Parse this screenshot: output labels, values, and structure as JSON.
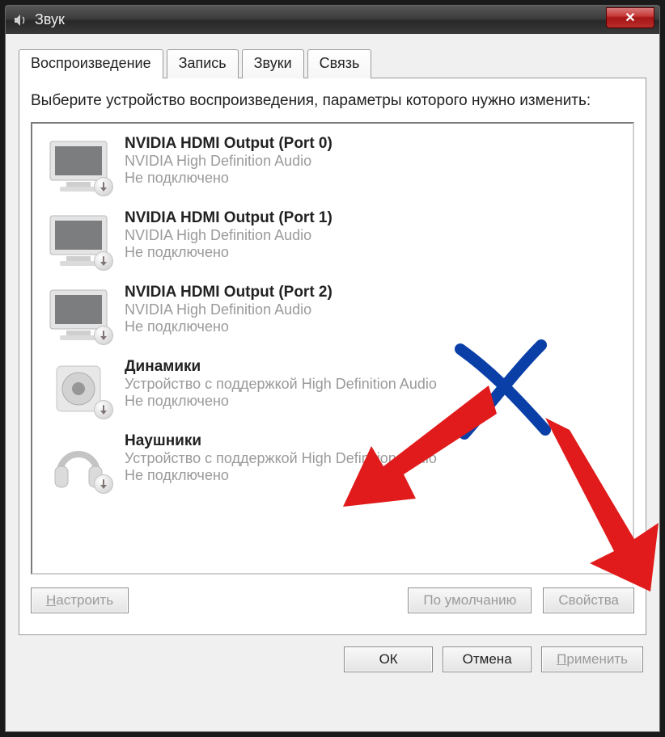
{
  "window": {
    "title": "Звук",
    "close_label": "✕"
  },
  "tabs": [
    {
      "label": "Воспроизведение",
      "active": true
    },
    {
      "label": "Запись",
      "active": false
    },
    {
      "label": "Звуки",
      "active": false
    },
    {
      "label": "Связь",
      "active": false
    }
  ],
  "instruction": "Выберите устройство воспроизведения, параметры которого нужно изменить:",
  "devices": [
    {
      "icon": "monitor",
      "name": "NVIDIA HDMI Output (Port 0)",
      "driver": "NVIDIA High Definition Audio",
      "status": "Не подключено"
    },
    {
      "icon": "monitor",
      "name": "NVIDIA HDMI Output (Port 1)",
      "driver": "NVIDIA High Definition Audio",
      "status": "Не подключено"
    },
    {
      "icon": "monitor",
      "name": "NVIDIA HDMI Output (Port 2)",
      "driver": "NVIDIA High Definition Audio",
      "status": "Не подключено"
    },
    {
      "icon": "speaker",
      "name": "Динамики",
      "driver": "Устройство с поддержкой High Definition Audio",
      "status": "Не подключено"
    },
    {
      "icon": "headphones",
      "name": "Наушники",
      "driver": "Устройство с поддержкой High Definition Audio",
      "status": "Не подключено"
    }
  ],
  "panel_buttons": {
    "configure": "Настроить",
    "default": "По умолчанию",
    "properties": "Свойства"
  },
  "dialog_buttons": {
    "ok": "ОК",
    "cancel": "Отмена",
    "apply": "Применить"
  },
  "colors": {
    "annotation_red": "#e11b1b",
    "annotation_blue": "#0a3fa8"
  }
}
